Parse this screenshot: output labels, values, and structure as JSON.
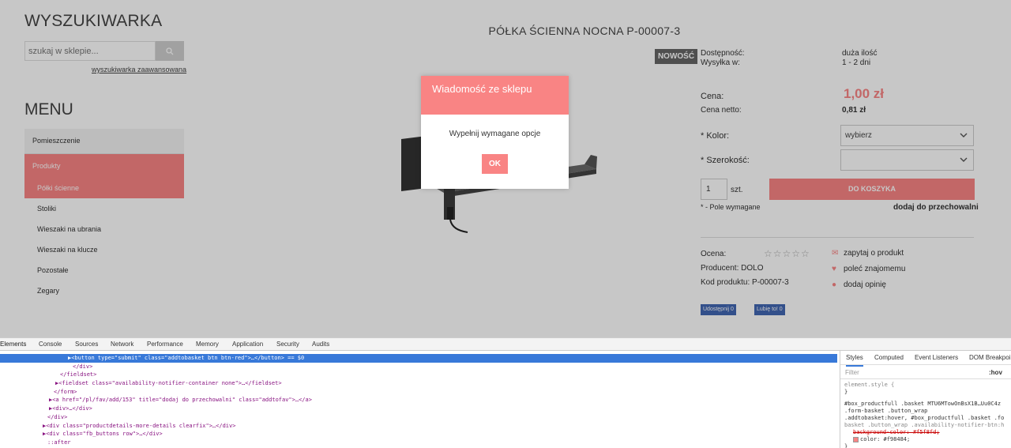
{
  "sidebar": {
    "search_heading": "WYSZUKIWARKA",
    "search_placeholder": "szukaj w sklepie...",
    "advanced_search": "wyszukiwarka zaawansowana",
    "menu_heading": "MENU",
    "menu_items": [
      {
        "label": "Pomieszczenie"
      },
      {
        "label": "Produkty"
      },
      {
        "label": "Półki ścienne"
      },
      {
        "label": "Stoliki"
      },
      {
        "label": "Wieszaki na ubrania"
      },
      {
        "label": "Wieszaki na klucze"
      },
      {
        "label": "Pozostałe"
      },
      {
        "label": "Zegary"
      }
    ]
  },
  "product": {
    "title": "PÓŁKA ŚCIENNA NOCNA P-00007-3",
    "badge": "NOWOŚĆ",
    "availability_label": "Dostępność:",
    "availability_value": "duża ilość",
    "shipping_label": "Wysyłka w:",
    "shipping_value": "1 - 2 dni",
    "price_label": "Cena:",
    "price": "1,00 zł",
    "net_label": "Cena netto:",
    "net_price": "0,81 zł",
    "color_label": "* Kolor:",
    "color_value": "wybierz",
    "width_label": "* Szerokość:",
    "width_value": "",
    "quantity": "1",
    "unit": "szt.",
    "add_to_basket": "DO KOSZYKA",
    "required_note": "* - Pole wymagane",
    "add_to_favorites": "dodaj do przechowalni",
    "rating_label": "Ocena:",
    "rating_stars": "☆☆☆☆☆",
    "producer_label": "Producent:",
    "producer_value": "DOLO",
    "code_label": "Kod produktu:",
    "code_value": "P-00007-3",
    "ask_about": "zapytaj o produkt",
    "recommend": "poleć znajomemu",
    "add_review": "dodaj opinię",
    "fb_share": "Udostępnij 0",
    "fb_like": "Lubię to! 0"
  },
  "modal": {
    "title": "Wiadomość ze sklepu",
    "message": "Wypełnij wymagane opcje",
    "ok_label": "OK"
  },
  "devtools": {
    "tabs": [
      "Elements",
      "Console",
      "Sources",
      "Network",
      "Performance",
      "Memory",
      "Application",
      "Security",
      "Audits"
    ],
    "code_lines": [
      "▶<button type=\"submit\" class=\"addtobasket btn btn-red\">…</button> == $0",
      "</div>",
      "</fieldset>",
      "▶<fieldset class=\"availability-notifier-container none\">…</fieldset>",
      "</form>",
      "▶<a href=\"/pl/fav/add/153\" title=\"dodaj do przechowalni\" class=\"addtofav\">…</a>",
      "▶<div>…</div>",
      "</div>",
      "▶<div class=\"productdetails-more-details clearfix\">…</div>",
      "▶<div class=\"fb_buttons row\">…</div>",
      "::after"
    ],
    "styles_tabs": [
      "Styles",
      "Computed",
      "Event Listeners",
      "DOM Breakpoi"
    ],
    "filter_placeholder": "Filter",
    "filter_hov": ":hov",
    "style_lines": [
      "element.style {",
      "}",
      "#box_productfull .basket  MTU6MTowOnBsX1B…Uu0C4z",
      ".form-basket .button_wrap",
      ".addtobasket:hover, #box_productfull .basket .fo",
      "basket .button_wrap .availability-notifier-btn:h",
      "background-color: #f5f8fd;",
      "color: #f98484;",
      "}"
    ]
  },
  "colors": {
    "accent": "#f98484",
    "badge": "#666666",
    "facebook": "#4267b2"
  }
}
